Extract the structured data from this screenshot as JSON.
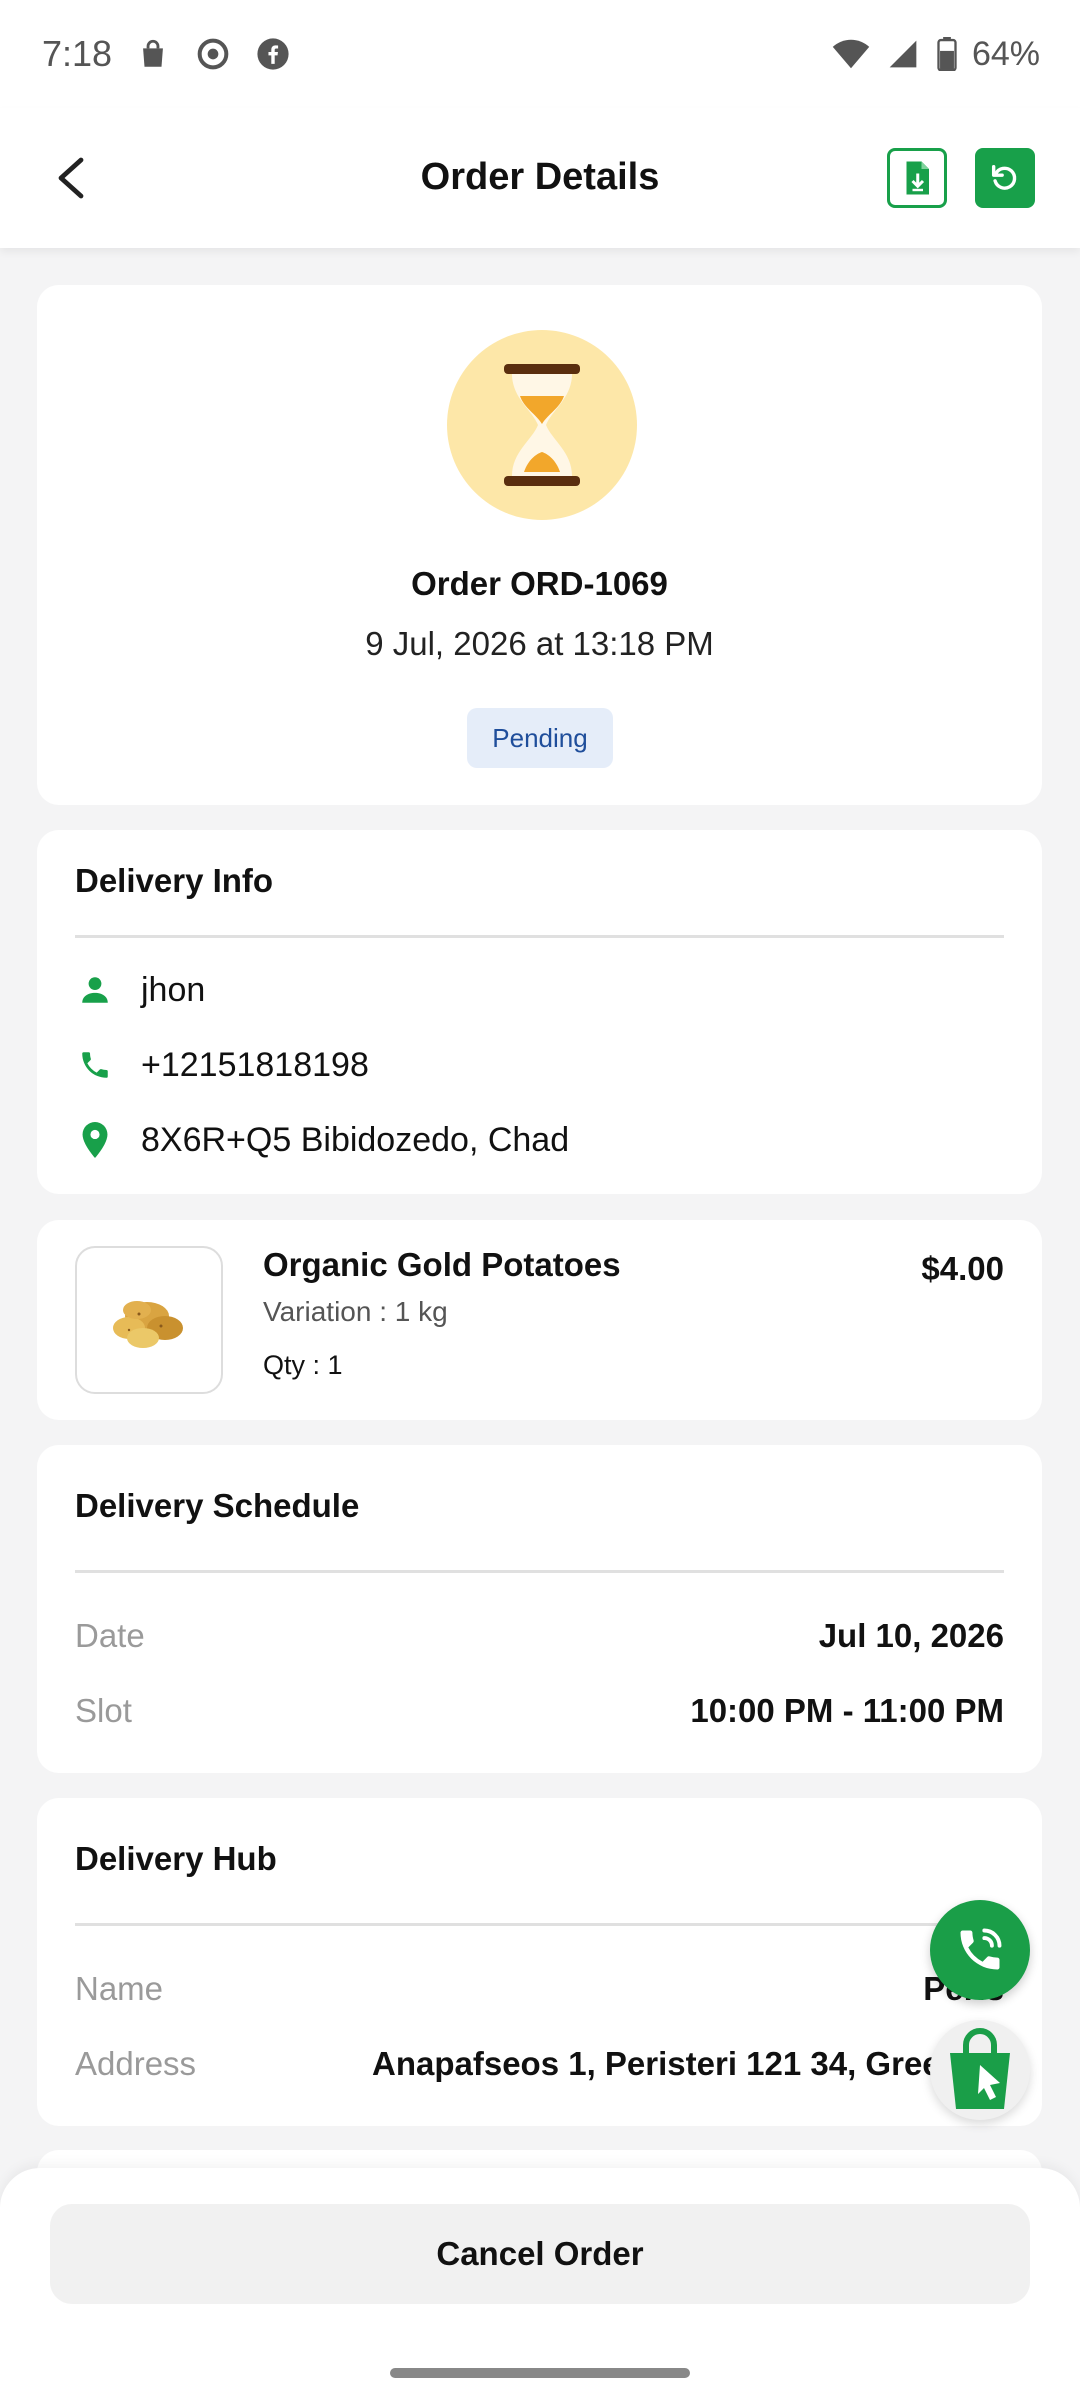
{
  "status_bar": {
    "time": "7:18",
    "battery": "64%",
    "left_icons": [
      "shopping-bag-icon",
      "chrome-icon",
      "facebook-icon"
    ],
    "right_icons": [
      "wifi-icon",
      "signal-icon",
      "battery-icon"
    ]
  },
  "app_bar": {
    "title": "Order Details",
    "back_icon": "chevron-left-icon",
    "actions": [
      "invoice-download-icon",
      "refresh-icon"
    ],
    "accent_color": "#18a04a"
  },
  "order": {
    "id_label": "Order ORD-1069",
    "date": "9 Jul, 2026 at 13:18 PM",
    "status": "Pending",
    "status_icon": "hourglass-icon"
  },
  "delivery_info": {
    "title": "Delivery Info",
    "name": "jhon",
    "phone": "+12151818198",
    "address": "8X6R+Q5 Bibidozedo, Chad"
  },
  "product": {
    "name": "Organic Gold Potatoes",
    "variation": "Variation : 1 kg",
    "qty": "Qty : 1",
    "price": "$4.00",
    "image": "potatoes-image"
  },
  "schedule": {
    "title": "Delivery Schedule",
    "date_label": "Date",
    "date_value": "Jul 10, 2026",
    "slot_label": "Slot",
    "slot_value": "10:00 PM - 11:00 PM"
  },
  "hub": {
    "title": "Delivery Hub",
    "name_label": "Name",
    "name_value": "Peris",
    "address_label": "Address",
    "address_value": "Anapafseos 1, Peristeri 121 34, Greece"
  },
  "actions": {
    "cancel_label": "Cancel Order"
  },
  "fabs": [
    "phone-call-icon",
    "shopping-cart-cursor-icon"
  ]
}
